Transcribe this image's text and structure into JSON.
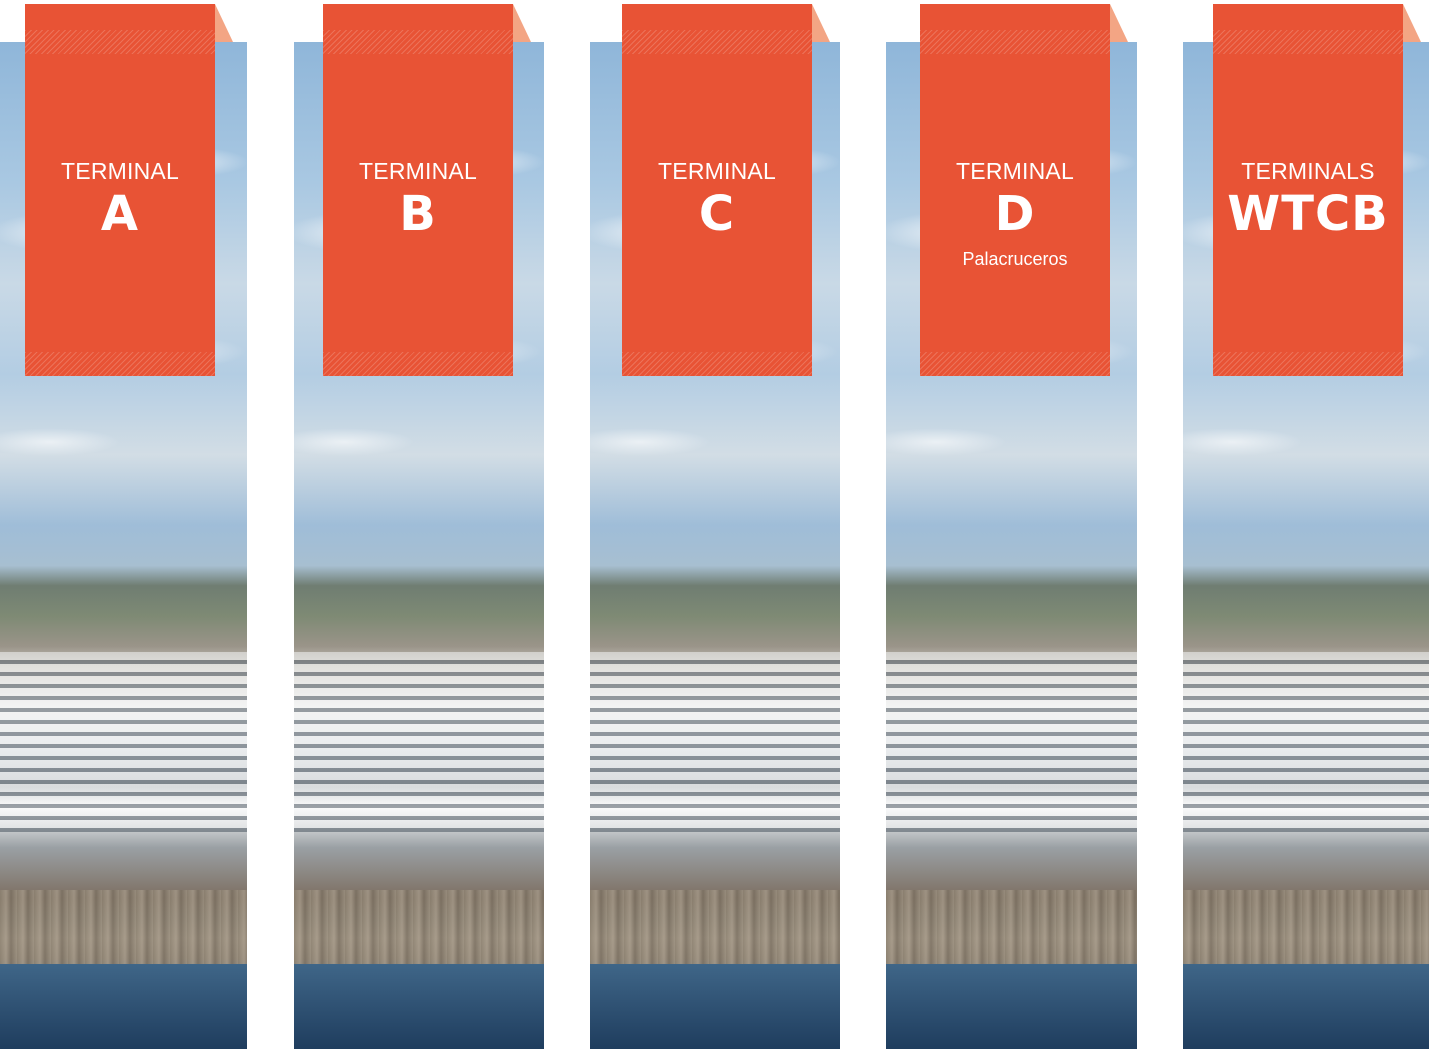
{
  "colors": {
    "ribbon": "#e85335",
    "fold": "#f3a584",
    "text": "#ffffff"
  },
  "terminals": [
    {
      "label": "TERMINAL",
      "code": "A",
      "subtitle": ""
    },
    {
      "label": "TERMINAL",
      "code": "B",
      "subtitle": ""
    },
    {
      "label": "TERMINAL",
      "code": "C",
      "subtitle": ""
    },
    {
      "label": "TERMINAL",
      "code": "D",
      "subtitle": "Palacruceros"
    },
    {
      "label": "TERMINALS",
      "code": "WTCB",
      "subtitle": ""
    }
  ]
}
